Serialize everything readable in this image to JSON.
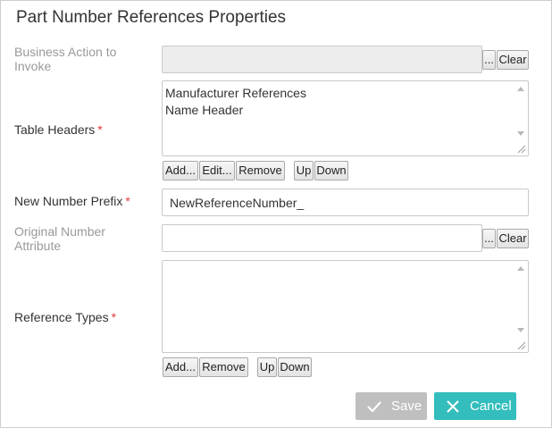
{
  "dialog": {
    "title": "Part Number References Properties"
  },
  "business_action": {
    "label": "Business Action to Invoke",
    "value": "",
    "browse_label": "...",
    "clear_label": "Clear"
  },
  "table_headers": {
    "label": "Table Headers",
    "required_mark": "*",
    "items": [
      "Manufacturer References",
      "Name Header"
    ],
    "buttons": {
      "add": "Add...",
      "edit": "Edit...",
      "remove": "Remove",
      "up": "Up",
      "down": "Down"
    }
  },
  "new_number_prefix": {
    "label": "New Number Prefix",
    "required_mark": "*",
    "value": "NewReferenceNumber_"
  },
  "original_number_attribute": {
    "label": "Original Number Attribute",
    "value": "",
    "browse_label": "...",
    "clear_label": "Clear"
  },
  "reference_types": {
    "label": "Reference Types",
    "required_mark": "*",
    "items": [],
    "buttons": {
      "add": "Add...",
      "remove": "Remove",
      "up": "Up",
      "down": "Down"
    }
  },
  "footer": {
    "save_label": "Save",
    "cancel_label": "Cancel"
  },
  "colors": {
    "save_bg": "#bfbfbf",
    "cancel_bg": "#33bdbd",
    "required": "#e03a3a",
    "muted_label": "#999999"
  },
  "icons": {
    "save": "check-icon",
    "cancel": "close-icon"
  }
}
